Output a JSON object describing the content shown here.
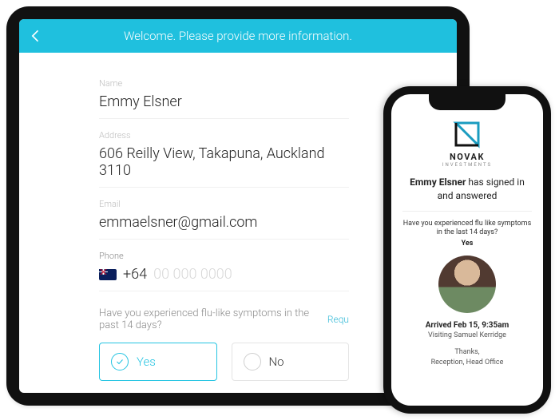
{
  "tablet": {
    "header": {
      "title": "Welcome. Please provide more information."
    },
    "fields": {
      "name": {
        "label": "Name",
        "value": "Emmy Elsner"
      },
      "address": {
        "label": "Address",
        "value": "606 Reilly View, Takapuna, Auckland 3110"
      },
      "email": {
        "label": "Email",
        "value": "emmaelsner@gmail.com"
      },
      "phone": {
        "label": "Phone",
        "country_code": "+64",
        "placeholder": "00 000 0000",
        "flag": "nz"
      }
    },
    "question": {
      "text": "Have you experienced flu-like symptoms in the past 14 days?",
      "required_label": "Requ",
      "options": {
        "yes": "Yes",
        "no": "No"
      },
      "selected": "yes"
    }
  },
  "phone": {
    "brand": {
      "name": "NOVAK",
      "sub": "INVESTMENTS"
    },
    "signed_in": {
      "name": "Emmy Elsner",
      "suffix": " has signed in and answered"
    },
    "question": {
      "text": "Have you experienced flu like symptoms in the last 14 days?",
      "answer": "Yes"
    },
    "arrival": {
      "line": "Arrived Feb 15, 9:35am",
      "visiting": "Visiting Samuel Kerridge"
    },
    "footer": {
      "thanks": "Thanks,",
      "from": "Reception, Head Office"
    }
  }
}
